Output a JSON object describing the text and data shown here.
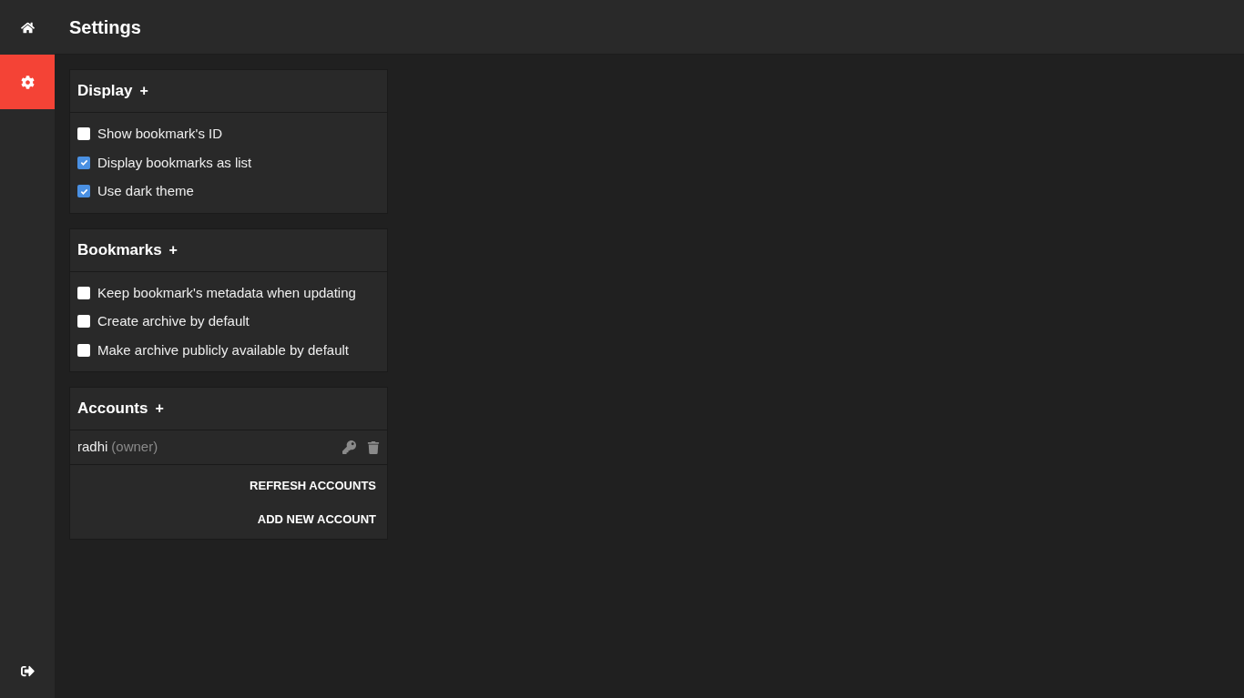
{
  "nav": [
    {
      "kind": "home",
      "selected": false
    },
    {
      "kind": "settings",
      "selected": true
    },
    {
      "kind": "logout",
      "selected": false
    }
  ],
  "header": {
    "title": "Settings"
  },
  "sections": [
    {
      "kind": "checkboxes",
      "title": "Display",
      "toggle": "+",
      "options": [
        {
          "label": "Show bookmark's ID",
          "checked": false
        },
        {
          "label": "Display bookmarks as list",
          "checked": true
        },
        {
          "label": "Use dark theme",
          "checked": true
        }
      ]
    },
    {
      "kind": "checkboxes",
      "title": "Bookmarks",
      "toggle": "+",
      "options": [
        {
          "label": "Keep bookmark's metadata when updating",
          "checked": false
        },
        {
          "label": "Create archive by default",
          "checked": false
        },
        {
          "label": "Make archive publicly available by default",
          "checked": false
        }
      ]
    },
    {
      "kind": "accounts",
      "title": "Accounts",
      "toggle": "+",
      "accounts": [
        {
          "name": "radhi",
          "role": "(owner)"
        }
      ],
      "buttons": [
        "REFRESH ACCOUNTS",
        "ADD NEW ACCOUNT"
      ]
    }
  ]
}
